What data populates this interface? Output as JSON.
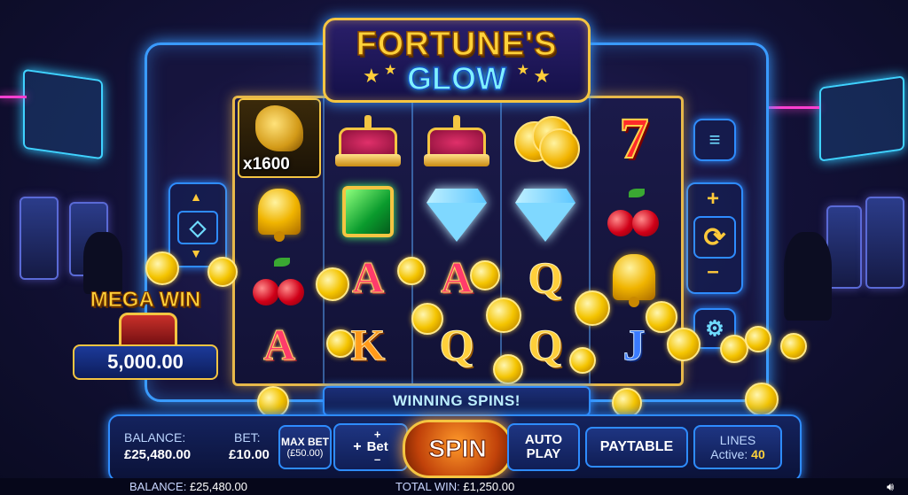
{
  "title": {
    "line1": "FORTUNE'S",
    "line2": "GLOW"
  },
  "reels": {
    "multiplier": "x1600",
    "grid": [
      [
        "dragon",
        "crown",
        "crown",
        "coins",
        "seven"
      ],
      [
        "bell",
        "green-gem",
        "diamond",
        "diamond",
        "cherry"
      ],
      [
        "cherry",
        "A",
        "A",
        "Q",
        "bell"
      ],
      [
        "A",
        "K",
        "Q",
        "Q",
        "J"
      ]
    ]
  },
  "mega_win": {
    "label": "MEGA WIN",
    "amount": "5,000.00"
  },
  "banner": "WINNING SPINS!",
  "controls": {
    "balance_label": "BALANCE:",
    "balance_value": "£25,480.00",
    "bet_label": "BET:",
    "bet_value": "£10.00",
    "max_bet_label": "MAX BET",
    "max_bet_value": "(£50.00)",
    "bet_adjust_label": "Bet",
    "spin_label": "SPIN",
    "auto_play_line1": "AUTO",
    "auto_play_line2": "PLAY",
    "paytable_label": "PAYTABLE",
    "lines_label": "LINES",
    "lines_active_label": "Active:",
    "lines_active_value": "40"
  },
  "status_bar": {
    "balance_label": "BALANCE:",
    "balance_value": "£25,480.00",
    "total_win_label": "TOTAL WIN:",
    "total_win_value": "£1,250.00",
    "volume_icon": "speaker-icon"
  },
  "side_buttons": {
    "left": [
      "chevron-up-icon",
      "diamond-icon",
      "chevron-down-icon"
    ],
    "right": [
      "menu-icon",
      "plus-icon",
      "refresh-icon",
      "minus-icon",
      "gear-icon"
    ]
  },
  "colors": {
    "accent": "#2e8cff",
    "gold": "#f4c542",
    "spin": "#c1420a"
  }
}
